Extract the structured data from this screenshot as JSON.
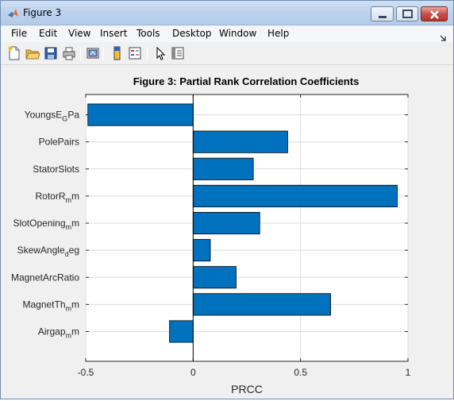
{
  "window": {
    "title": "Figure 3"
  },
  "menu": {
    "items": [
      "File",
      "Edit",
      "View",
      "Insert",
      "Tools",
      "Desktop",
      "Window",
      "Help"
    ]
  },
  "toolbar": {
    "buttons": [
      {
        "name": "new-figure-icon"
      },
      {
        "name": "open-file-icon"
      },
      {
        "name": "save-icon"
      },
      {
        "name": "print-icon"
      },
      {
        "name": "link-plot-icon"
      },
      {
        "name": "insert-colorbar-icon"
      },
      {
        "name": "insert-legend-icon"
      },
      {
        "name": "edit-plot-pointer-icon"
      },
      {
        "name": "property-inspector-icon"
      }
    ]
  },
  "colors": {
    "bar_fill": "#0072bd",
    "axes_bg": "#ffffff",
    "figure_bg": "#f0f0f0",
    "grid": "#dcdcdc"
  },
  "chart_data": {
    "type": "bar",
    "orientation": "horizontal",
    "title": "Figure 3: Partial Rank Correlation Coefficients",
    "xlabel": "PRCC",
    "ylabel": "",
    "xlim": [
      -0.5,
      1
    ],
    "xticks": [
      -0.5,
      0,
      0.5,
      1
    ],
    "xtick_labels": [
      "-0.5",
      "0",
      "0.5",
      "1"
    ],
    "grid": true,
    "categories": [
      {
        "base": "YoungsE",
        "sub": "G",
        "rest": "Pa"
      },
      {
        "base": "PolePairs",
        "sub": "",
        "rest": ""
      },
      {
        "base": "StatorSlots",
        "sub": "",
        "rest": ""
      },
      {
        "base": "RotorR",
        "sub": "m",
        "rest": "m"
      },
      {
        "base": "SlotOpening",
        "sub": "m",
        "rest": "m"
      },
      {
        "base": "SkewAngle",
        "sub": "d",
        "rest": "eg"
      },
      {
        "base": "MagnetArcRatio",
        "sub": "",
        "rest": ""
      },
      {
        "base": "MagnetTh",
        "sub": "m",
        "rest": "m"
      },
      {
        "base": "Airgap",
        "sub": "m",
        "rest": "m"
      }
    ],
    "values": [
      -0.49,
      0.44,
      0.28,
      0.95,
      0.31,
      0.08,
      0.2,
      0.64,
      -0.11
    ]
  }
}
